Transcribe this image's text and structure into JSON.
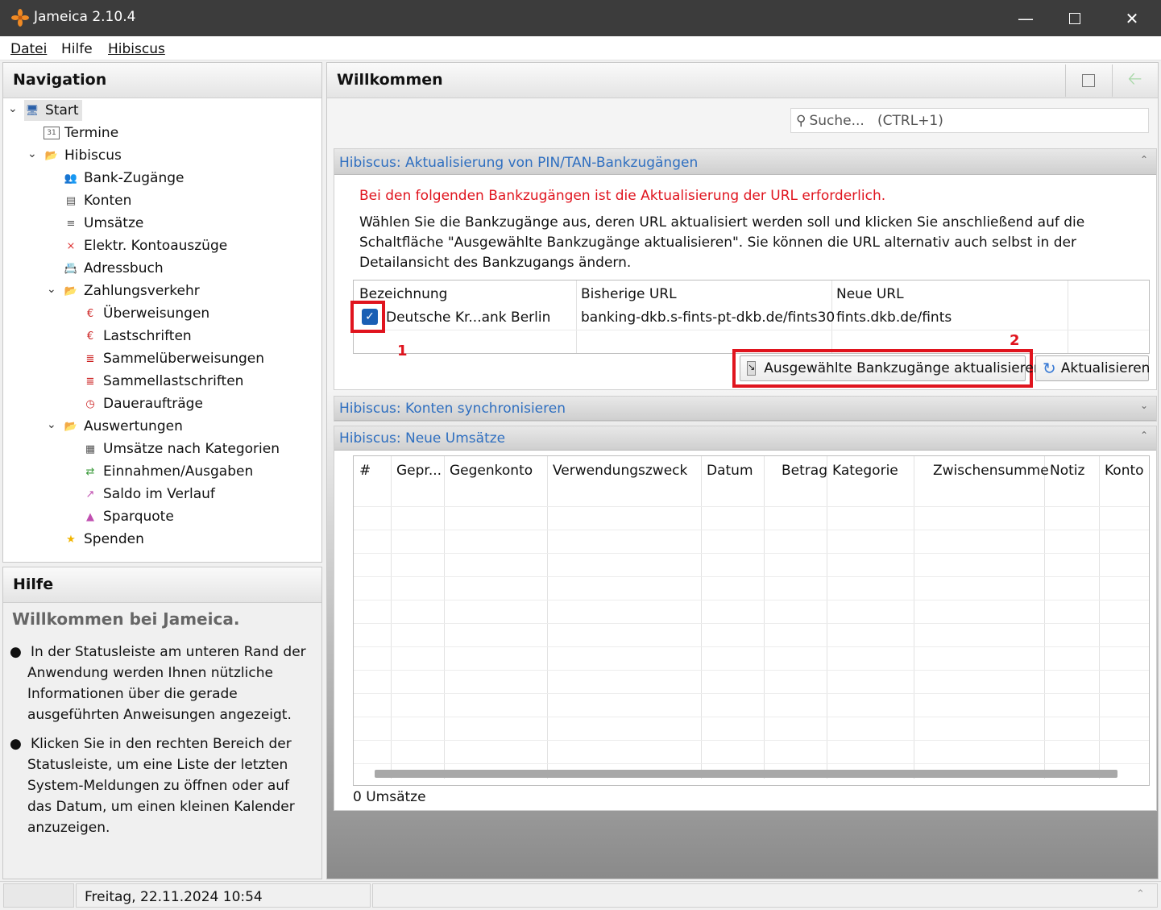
{
  "window": {
    "title": "Jameica 2.10.4"
  },
  "menu": {
    "items": [
      "Datei",
      "Hilfe",
      "Hibiscus"
    ]
  },
  "navigation": {
    "title": "Navigation",
    "items": [
      {
        "label": "Start",
        "icon": "computer-icon"
      },
      {
        "label": "Termine",
        "icon": "calendar-icon"
      },
      {
        "label": "Hibiscus",
        "icon": "folder-icon"
      },
      {
        "label": "Bank-Zugänge",
        "icon": "users-icon"
      },
      {
        "label": "Konten",
        "icon": "account-icon"
      },
      {
        "label": "Umsätze",
        "icon": "transactions-icon"
      },
      {
        "label": "Elektr. Kontoauszüge",
        "icon": "pdf-icon"
      },
      {
        "label": "Adressbuch",
        "icon": "addressbook-icon"
      },
      {
        "label": "Zahlungsverkehr",
        "icon": "folder-icon"
      },
      {
        "label": "Überweisungen",
        "icon": "transfer-icon"
      },
      {
        "label": "Lastschriften",
        "icon": "debit-icon"
      },
      {
        "label": "Sammelüberweisungen",
        "icon": "batch-transfer-icon"
      },
      {
        "label": "Sammellastschriften",
        "icon": "batch-debit-icon"
      },
      {
        "label": "Daueraufträge",
        "icon": "clock-icon"
      },
      {
        "label": "Auswertungen",
        "icon": "folder-icon"
      },
      {
        "label": "Umsätze nach Kategorien",
        "icon": "category-icon"
      },
      {
        "label": "Einnahmen/Ausgaben",
        "icon": "income-expense-icon"
      },
      {
        "label": "Saldo im Verlauf",
        "icon": "chart-icon"
      },
      {
        "label": "Sparquote",
        "icon": "savings-chart-icon"
      },
      {
        "label": "Spenden",
        "icon": "star-icon"
      }
    ]
  },
  "help": {
    "title": "Hilfe",
    "heading": "Willkommen bei Jameica.",
    "bullets": [
      "In der Statusleiste am unteren Rand der Anwendung werden Ihnen nützliche Informationen über die gerade ausgeführten Anweisungen angezeigt.",
      "Klicken Sie in den rechten Bereich der Statusleiste, um eine Liste der letzten System-Meldungen zu öffnen oder auf das Datum, um einen kleinen Kalender anzuzeigen."
    ]
  },
  "main": {
    "title": "Willkommen",
    "search_placeholder": "Suche...   (CTRL+1)"
  },
  "update_section": {
    "title": "Hibiscus: Aktualisierung von PIN/TAN-Bankzugängen",
    "warning": "Bei den folgenden Bankzugängen ist die Aktualisierung der URL erforderlich.",
    "description": "Wählen Sie die Bankzugänge aus, deren URL aktualisiert werden soll und klicken Sie anschließend auf die Schaltfläche \"Ausgewählte Bankzugänge aktualisieren\". Sie können die URL alternativ auch selbst in der Detailansicht des Bankzugangs ändern.",
    "columns": [
      "Bezeichnung",
      "Bisherige URL",
      "Neue URL"
    ],
    "rows": [
      {
        "checked": true,
        "name": "Deutsche Kr...ank Berlin",
        "old_url": "banking-dkb.s-fints-pt-dkb.de/fints30",
        "new_url": "fints.dkb.de/fints"
      }
    ],
    "update_button": "Ausgewählte Bankzugänge aktualisieren",
    "refresh_button": "Aktualisieren",
    "marker1": "1",
    "marker2": "2"
  },
  "sync_section": {
    "title": "Hibiscus: Konten synchronisieren"
  },
  "new_tx_section": {
    "title": "Hibiscus: Neue Umsätze",
    "columns": [
      "#",
      "Gepr...",
      "Gegenkonto",
      "Verwendungszweck",
      "Datum",
      "Betrag",
      "Kategorie",
      "Zwischensumme",
      "Notiz",
      "Konto"
    ],
    "count_text": "0 Umsätze"
  },
  "statusbar": {
    "datetime": "Freitag, 22.11.2024 10:54"
  },
  "colors": {
    "accent": "#2f6fc0",
    "warning": "#e0141e",
    "highlight": "#e0141e"
  }
}
